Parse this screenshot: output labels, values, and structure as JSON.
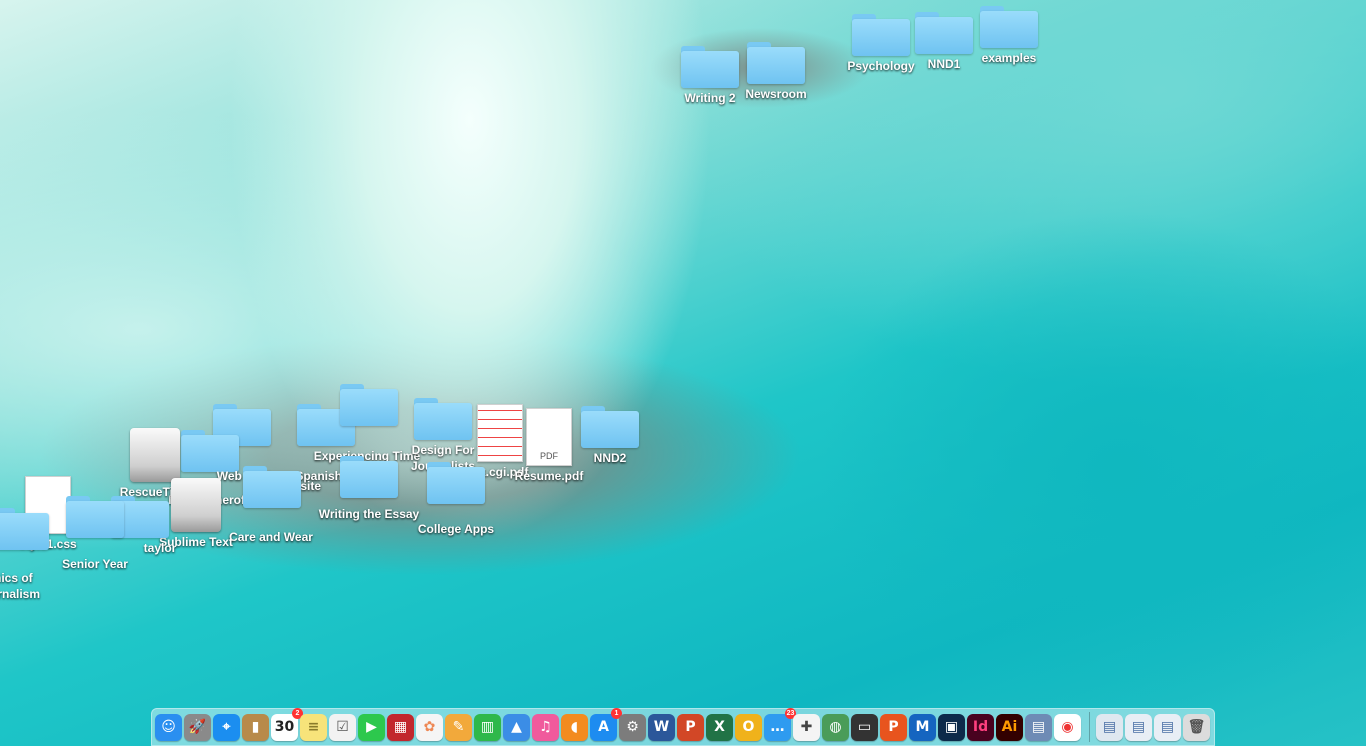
{
  "desktop": {
    "items": [
      {
        "label": "Writing 2",
        "kind": "folder"
      },
      {
        "label": "Newsroom",
        "kind": "folder"
      },
      {
        "label": "Psychology",
        "kind": "folder"
      },
      {
        "label": "NND1",
        "kind": "folder"
      },
      {
        "label": "examples",
        "kind": "folder"
      },
      {
        "label": "Experiencing Time",
        "kind": "folder"
      },
      {
        "label": "Design For Journalists",
        "kind": "folder"
      },
      {
        "label": "nk.cgi.pdf",
        "kind": "pdf"
      },
      {
        "label": "Resume.pdf",
        "kind": "pdf",
        "tag": "PDF"
      },
      {
        "label": "NND2",
        "kind": "folder"
      },
      {
        "label": "Web Design",
        "kind": "folder"
      },
      {
        "label": "Spanish 1 and 2",
        "kind": "folder"
      },
      {
        "label": "bsite",
        "kind": "folder"
      },
      {
        "label": "Mark Benerofe",
        "kind": "folder"
      },
      {
        "label": "RescueTime",
        "kind": "drive"
      },
      {
        "label": "Writing the Essay",
        "kind": "folder"
      },
      {
        "label": "College Apps",
        "kind": "folder"
      },
      {
        "label": "Care and Wear",
        "kind": "folder"
      },
      {
        "label": "Sublime Text",
        "kind": "drive"
      },
      {
        "label": "taylor",
        "kind": "folder"
      },
      {
        "label": "style1.css",
        "kind": "doc"
      },
      {
        "label": "Senior Year",
        "kind": "folder"
      },
      {
        "label": "thics of urnalism",
        "kind": "folder"
      }
    ]
  },
  "dock": {
    "apps": [
      {
        "name": "finder-icon",
        "color": "#2a8ff0",
        "glyph": "☺"
      },
      {
        "name": "launchpad-icon",
        "color": "#8a8a8a",
        "glyph": "🚀"
      },
      {
        "name": "safari-icon",
        "color": "#1b8ef0",
        "glyph": "⌖"
      },
      {
        "name": "contacts-icon",
        "color": "#b88a4a",
        "glyph": "▮"
      },
      {
        "name": "calendar-icon",
        "color": "#ffffff",
        "glyph": "30",
        "badge": "2",
        "text": "#222"
      },
      {
        "name": "notes-icon",
        "color": "#f7e37a",
        "glyph": "≡",
        "text": "#8a7a2a"
      },
      {
        "name": "reminders-icon",
        "color": "#f2f2f2",
        "glyph": "☑",
        "text": "#555"
      },
      {
        "name": "facetime-icon",
        "color": "#2dc84d",
        "glyph": "▶"
      },
      {
        "name": "photo-booth-icon",
        "color": "#c2272d",
        "glyph": "▦"
      },
      {
        "name": "photos-icon",
        "color": "#f5f5f5",
        "glyph": "✿",
        "text": "#e85"
      },
      {
        "name": "pages-icon",
        "color": "#f2a93b",
        "glyph": "✎"
      },
      {
        "name": "numbers-icon",
        "color": "#2fb84b",
        "glyph": "▥"
      },
      {
        "name": "keynote-icon",
        "color": "#3b8de6",
        "glyph": "▲"
      },
      {
        "name": "itunes-icon",
        "color": "#f05a9c",
        "glyph": "♫"
      },
      {
        "name": "ibooks-icon",
        "color": "#f38b1f",
        "glyph": "◖"
      },
      {
        "name": "app-store-icon",
        "color": "#1d8cf0",
        "glyph": "A",
        "badge": "1"
      },
      {
        "name": "system-preferences-icon",
        "color": "#7c7c7c",
        "glyph": "⚙"
      },
      {
        "name": "word-icon",
        "color": "#2b579a",
        "glyph": "W"
      },
      {
        "name": "powerpoint-icon",
        "color": "#d24726",
        "glyph": "P"
      },
      {
        "name": "excel-icon",
        "color": "#217346",
        "glyph": "X"
      },
      {
        "name": "outlook-icon",
        "color": "#f0b21b",
        "glyph": "O"
      },
      {
        "name": "messenger-icon",
        "color": "#2e9bf0",
        "glyph": "…",
        "badge": "23"
      },
      {
        "name": "first-aid-icon",
        "color": "#f4f4f4",
        "glyph": "✚",
        "text": "#444"
      },
      {
        "name": "globe-icon",
        "color": "#4a9c59",
        "glyph": "◍"
      },
      {
        "name": "terminal-icon",
        "color": "#333333",
        "glyph": "▭"
      },
      {
        "name": "powerpoint-alt-icon",
        "color": "#e8541e",
        "glyph": "P"
      },
      {
        "name": "malwarebytes-icon",
        "color": "#1565c0",
        "glyph": "M"
      },
      {
        "name": "window-icon",
        "color": "#0d2a4a",
        "glyph": "▣"
      },
      {
        "name": "indesign-icon",
        "color": "#49021f",
        "glyph": "Id",
        "text": "#ff3f7f"
      },
      {
        "name": "illustrator-icon",
        "color": "#330000",
        "glyph": "Ai",
        "text": "#ff9a00"
      },
      {
        "name": "preview-icon",
        "color": "#6e8bb5",
        "glyph": "▤"
      },
      {
        "name": "chrome-icon",
        "color": "#ffffff",
        "glyph": "◉",
        "text": "#e33"
      }
    ],
    "stacks": [
      {
        "name": "stack-screenshots-icon",
        "color": "#dfe8f0",
        "glyph": "▤",
        "text": "#4a6fa5"
      },
      {
        "name": "stack-documents-icon",
        "color": "#e8eef5",
        "glyph": "▤",
        "text": "#4a6fa5"
      },
      {
        "name": "stack-downloads-icon",
        "color": "#e8eef5",
        "glyph": "▤",
        "text": "#4a6fa5"
      },
      {
        "name": "trash-icon",
        "color": "#dcdcdc",
        "glyph": "🗑",
        "text": "#555"
      }
    ]
  }
}
